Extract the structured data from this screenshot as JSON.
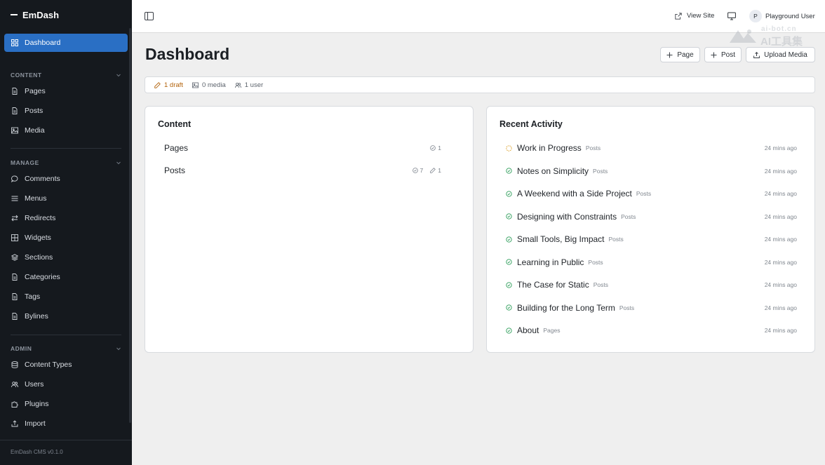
{
  "app": {
    "name": "EmDash",
    "version": "EmDash CMS v0.1.0"
  },
  "sidebar": {
    "dashboard": "Dashboard",
    "sections": [
      {
        "title": "CONTENT",
        "items": [
          "Pages",
          "Posts",
          "Media"
        ]
      },
      {
        "title": "MANAGE",
        "items": [
          "Comments",
          "Menus",
          "Redirects",
          "Widgets",
          "Sections",
          "Categories",
          "Tags",
          "Bylines"
        ]
      },
      {
        "title": "ADMIN",
        "items": [
          "Content Types",
          "Users",
          "Plugins",
          "Import"
        ]
      }
    ]
  },
  "header": {
    "view_site": "View Site",
    "avatar_initial": "P",
    "user_name": "Playground User"
  },
  "watermark": {
    "url": "ai-bot.cn",
    "label": "AI工具集"
  },
  "page": {
    "title": "Dashboard",
    "actions": {
      "page": "Page",
      "post": "Post",
      "upload": "Upload Media"
    }
  },
  "stats": {
    "draft": "1 draft",
    "media": "0 media",
    "users": "1 user"
  },
  "content_card": {
    "title": "Content",
    "rows": [
      {
        "name": "Pages",
        "published": "1",
        "drafts": ""
      },
      {
        "name": "Posts",
        "published": "7",
        "drafts": "1"
      }
    ]
  },
  "activity_card": {
    "title": "Recent Activity",
    "items": [
      {
        "title": "Work in Progress",
        "type": "Posts",
        "time": "24 mins ago",
        "status": "draft"
      },
      {
        "title": "Notes on Simplicity",
        "type": "Posts",
        "time": "24 mins ago",
        "status": "published"
      },
      {
        "title": "A Weekend with a Side Project",
        "type": "Posts",
        "time": "24 mins ago",
        "status": "published"
      },
      {
        "title": "Designing with Constraints",
        "type": "Posts",
        "time": "24 mins ago",
        "status": "published"
      },
      {
        "title": "Small Tools, Big Impact",
        "type": "Posts",
        "time": "24 mins ago",
        "status": "published"
      },
      {
        "title": "Learning in Public",
        "type": "Posts",
        "time": "24 mins ago",
        "status": "published"
      },
      {
        "title": "The Case for Static",
        "type": "Posts",
        "time": "24 mins ago",
        "status": "published"
      },
      {
        "title": "Building for the Long Term",
        "type": "Posts",
        "time": "24 mins ago",
        "status": "published"
      },
      {
        "title": "About",
        "type": "Pages",
        "time": "24 mins ago",
        "status": "published"
      }
    ]
  },
  "colors": {
    "sidebar_bg": "#15191e",
    "accent": "#2a6fc4",
    "draft": "#d99a1e",
    "published": "#2f9e5b"
  }
}
